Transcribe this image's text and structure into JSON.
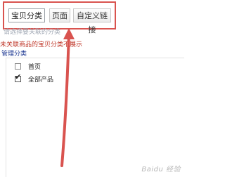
{
  "tabs": [
    {
      "label": "宝贝分类",
      "active": true
    },
    {
      "label": "页面",
      "active": false
    },
    {
      "label": "自定义链接",
      "active": false
    }
  ],
  "hint_text": "请选择要关联的分类",
  "warning_text": "未关联商品的宝贝分类不展示",
  "section_label": "管理分类",
  "items": [
    {
      "label": "首页",
      "checked": false
    },
    {
      "label": "全部产品",
      "checked": true
    }
  ],
  "checkmark_glyph": "✔",
  "watermark": "Baidu 经验",
  "colors": {
    "highlight": "#d9534f",
    "warning": "#c0392b",
    "section": "#1f3a93"
  }
}
